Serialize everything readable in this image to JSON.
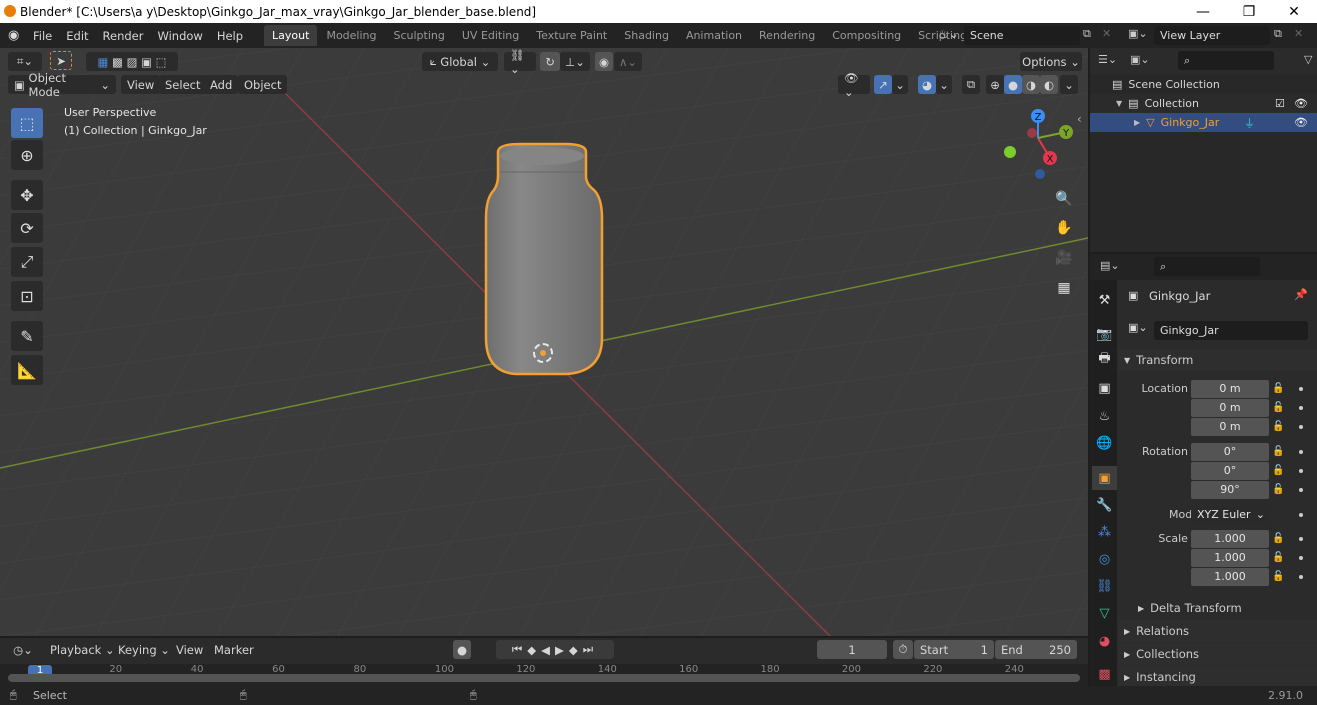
{
  "window": {
    "title": "Blender* [C:\\Users\\a y\\Desktop\\Ginkgo_Jar_max_vray\\Ginkgo_Jar_blender_base.blend]",
    "minimize": "—",
    "restore": "❐",
    "close": "✕"
  },
  "menubar": {
    "items": [
      "File",
      "Edit",
      "Render",
      "Window",
      "Help"
    ]
  },
  "workspaces": [
    "Layout",
    "Modeling",
    "Sculpting",
    "UV Editing",
    "Texture Paint",
    "Shading",
    "Animation",
    "Rendering",
    "Compositing",
    "Scripting"
  ],
  "active_workspace": "Layout",
  "add_workspace": "+",
  "scene": {
    "label": "Scene"
  },
  "view_layer": {
    "label": "View Layer"
  },
  "viewport": {
    "mode": "Object Mode",
    "menus": [
      "View",
      "Select",
      "Add",
      "Object"
    ],
    "orientation": "Global",
    "options": "Options",
    "overlay_title": "User Perspective",
    "overlay_subtitle": "(1) Collection | Ginkgo_Jar",
    "gizmo": {
      "x": "X",
      "y": "Y",
      "z": "Z"
    },
    "axis_colors": {
      "x": "#e5364d",
      "y": "#7ca528",
      "z": "#3c8ef5"
    },
    "selection_color": "#f1a031"
  },
  "outliner": {
    "search_placeholder": "",
    "rows": [
      {
        "label": "Scene Collection",
        "level": 0
      },
      {
        "label": "Collection",
        "level": 1
      },
      {
        "label": "Ginkgo_Jar",
        "level": 2,
        "selected": true
      }
    ]
  },
  "properties": {
    "search_placeholder": "",
    "object_name": "Ginkgo_Jar",
    "data_name": "Ginkgo_Jar",
    "transform_label": "Transform",
    "location": {
      "label": "Location X",
      "x": "0 m",
      "y": "0 m",
      "z": "0 m"
    },
    "rotation": {
      "label": "Rotation X",
      "x": "0°",
      "y": "0°",
      "z": "90°"
    },
    "mode_label": "Mode",
    "mode_value": "XYZ Euler",
    "scale": {
      "label": "Scale X",
      "x": "1.000",
      "y": "1.000",
      "z": "1.000"
    },
    "axis_y": "Y",
    "axis_z": "Z",
    "delta_transform": "Delta Transform",
    "relations": "Relations",
    "collections": "Collections",
    "instancing": "Instancing"
  },
  "timeline": {
    "menus": [
      "Playback",
      "Keying",
      "View",
      "Marker"
    ],
    "current_frame": "1",
    "start_label": "Start",
    "start_value": "1",
    "end_label": "End",
    "end_value": "250",
    "ruler": [
      "1",
      "20",
      "40",
      "60",
      "80",
      "100",
      "120",
      "140",
      "160",
      "180",
      "200",
      "220",
      "240"
    ]
  },
  "statusbar": {
    "select": "Select",
    "version": "2.91.0"
  }
}
